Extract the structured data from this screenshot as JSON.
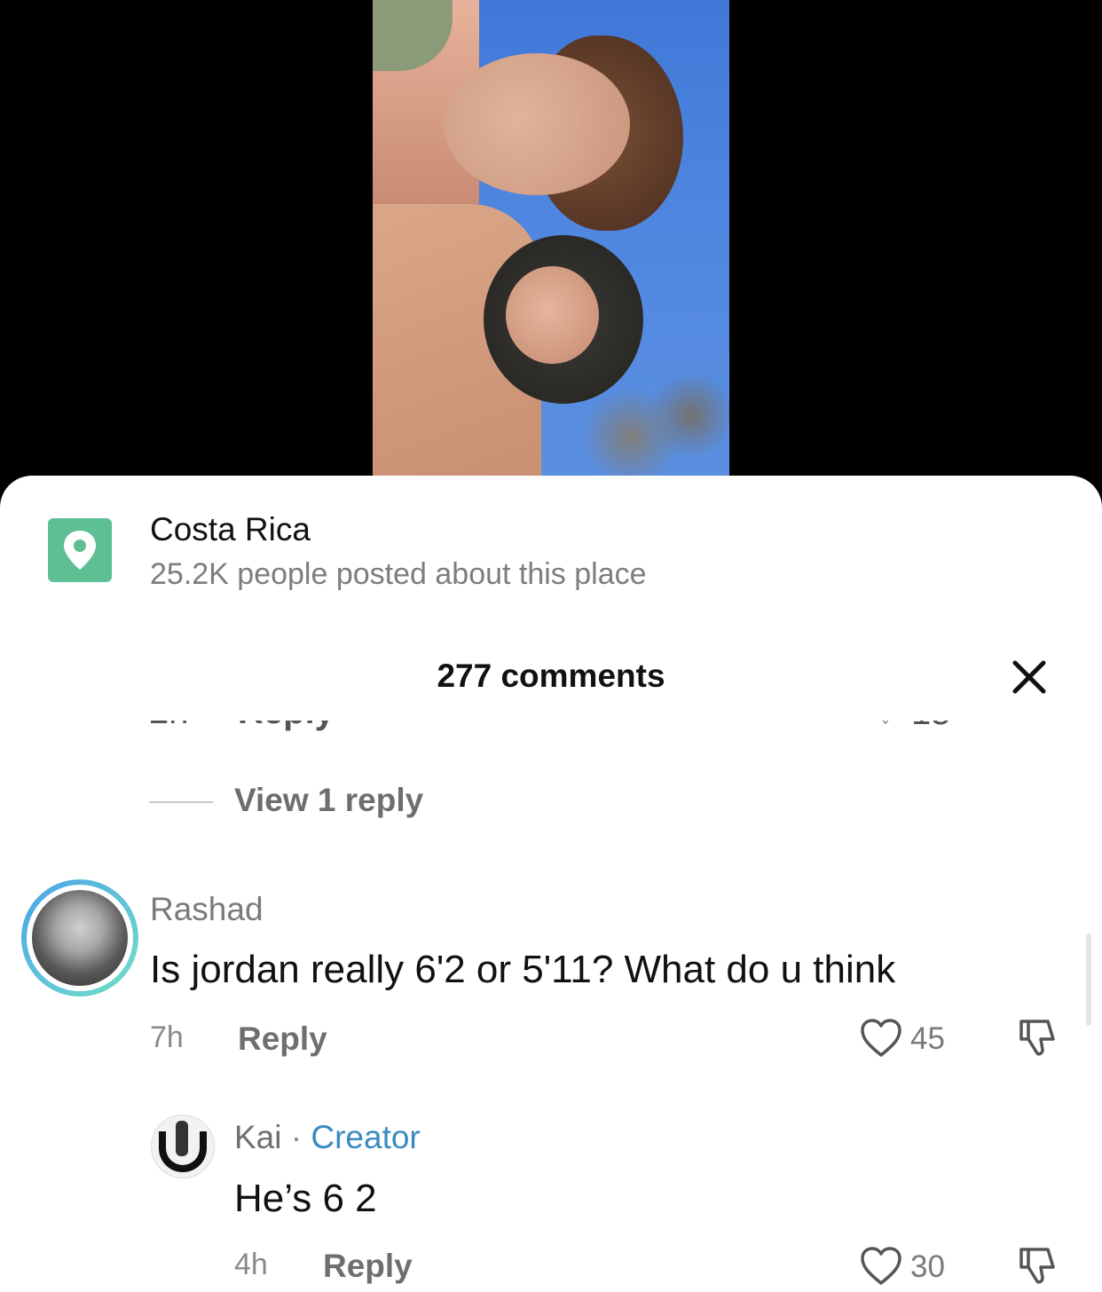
{
  "location": {
    "title": "Costa Rica",
    "subtitle": "25.2K people posted about this place",
    "icon": "location-pin-icon",
    "accent_color": "#5fbf94"
  },
  "comments_panel": {
    "title": "277 comments",
    "close_icon": "close-icon"
  },
  "thread": {
    "view_replies_label": "View 1 reply"
  },
  "comment": {
    "username": "Rashad",
    "text": "Is jordan really 6'2 or 5'11? What do u think",
    "time": "7h",
    "reply_label": "Reply",
    "likes": "45"
  },
  "reply": {
    "username": "Kai",
    "separator": "·",
    "badge": "Creator",
    "text": "He’s 6 2",
    "time": "4h",
    "reply_label": "Reply",
    "likes": "30",
    "badge_color": "#3a8bbf"
  }
}
